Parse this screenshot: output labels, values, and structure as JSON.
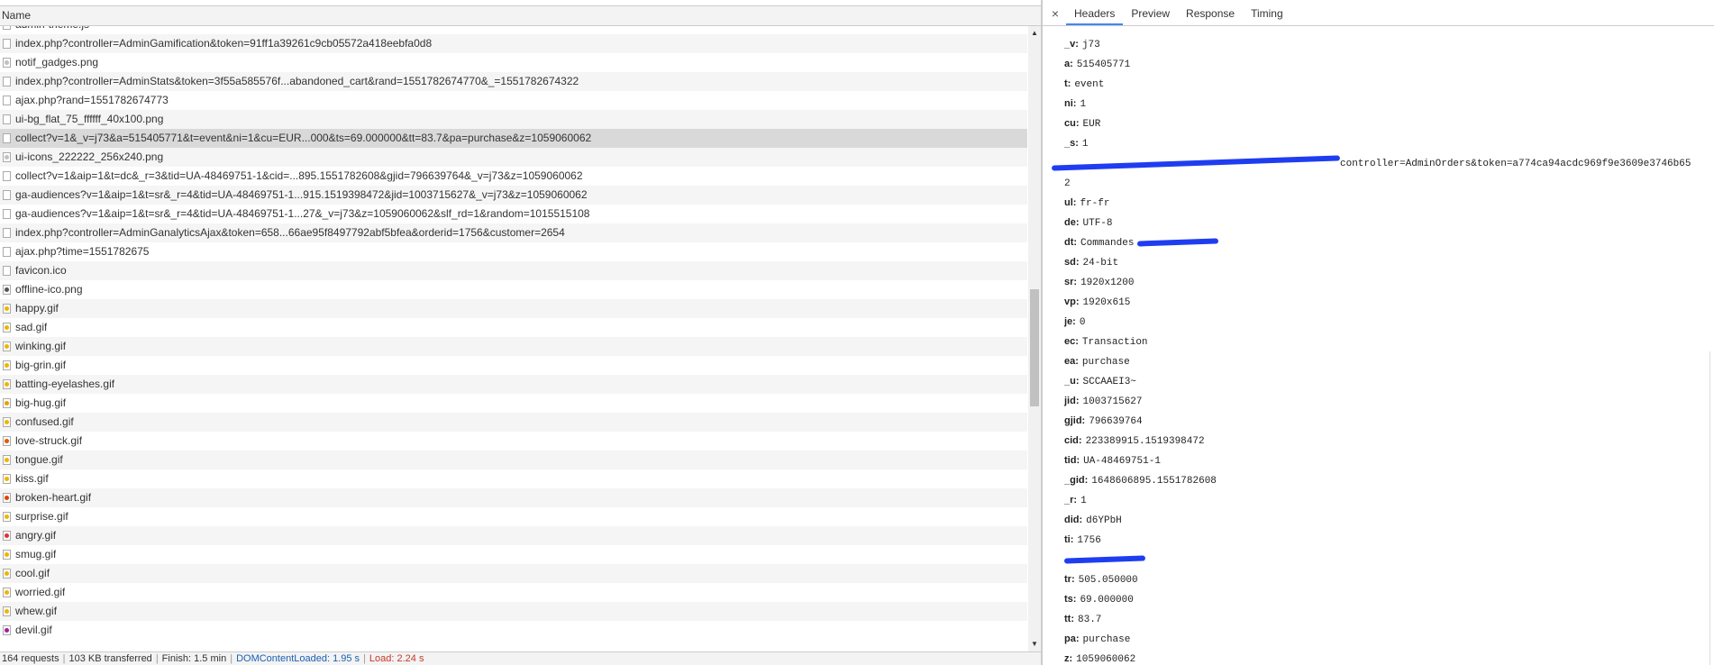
{
  "network": {
    "name_header": "Name",
    "files": [
      {
        "name": "admin-theme.js",
        "icon": "file-icon",
        "color": ""
      },
      {
        "name": "index.php?controller=AdminGamification&token=91ff1a39261c9cb05572a418eebfa0d8",
        "icon": "file-icon",
        "color": ""
      },
      {
        "name": "notif_gadges.png",
        "icon": "image-icon",
        "color": "#c0c0c0"
      },
      {
        "name": "index.php?controller=AdminStats&token=3f55a585576f...abandoned_cart&rand=1551782674770&_=1551782674322",
        "icon": "file-icon",
        "color": ""
      },
      {
        "name": "ajax.php?rand=1551782674773",
        "icon": "file-icon",
        "color": ""
      },
      {
        "name": "ui-bg_flat_75_ffffff_40x100.png",
        "icon": "file-icon",
        "color": ""
      },
      {
        "name": "collect?v=1&_v=j73&a=515405771&t=event&ni=1&cu=EUR...000&ts=69.000000&tt=83.7&pa=purchase&z=1059060062",
        "icon": "file-icon",
        "color": ""
      },
      {
        "name": "ui-icons_222222_256x240.png",
        "icon": "image-icon",
        "color": "#c0c0c0"
      },
      {
        "name": "collect?v=1&aip=1&t=dc&_r=3&tid=UA-48469751-1&cid=...895.1551782608&gjid=796639764&_v=j73&z=1059060062",
        "icon": "file-icon",
        "color": ""
      },
      {
        "name": "ga-audiences?v=1&aip=1&t=sr&_r=4&tid=UA-48469751-1...915.1519398472&jid=1003715627&_v=j73&z=1059060062",
        "icon": "file-icon",
        "color": ""
      },
      {
        "name": "ga-audiences?v=1&aip=1&t=sr&_r=4&tid=UA-48469751-1...27&_v=j73&z=1059060062&slf_rd=1&random=1015515108",
        "icon": "file-icon",
        "color": ""
      },
      {
        "name": "index.php?controller=AdminGanalyticsAjax&token=658...66ae95f8497792abf5bfea&orderid=1756&customer=2654",
        "icon": "file-icon",
        "color": ""
      },
      {
        "name": "ajax.php?time=1551782675",
        "icon": "file-icon",
        "color": ""
      },
      {
        "name": "favicon.ico",
        "icon": "file-icon",
        "color": ""
      },
      {
        "name": "offline-ico.png",
        "icon": "image-icon",
        "color": "#555555"
      },
      {
        "name": "happy.gif",
        "icon": "emoji-icon",
        "color": "#f0b400"
      },
      {
        "name": "sad.gif",
        "icon": "emoji-icon",
        "color": "#f0b400"
      },
      {
        "name": "winking.gif",
        "icon": "emoji-icon",
        "color": "#f0b400"
      },
      {
        "name": "big-grin.gif",
        "icon": "emoji-icon",
        "color": "#f0b400"
      },
      {
        "name": "batting-eyelashes.gif",
        "icon": "emoji-icon",
        "color": "#f0b400"
      },
      {
        "name": "big-hug.gif",
        "icon": "emoji-icon",
        "color": "#e8a000"
      },
      {
        "name": "confused.gif",
        "icon": "emoji-icon",
        "color": "#f0b400"
      },
      {
        "name": "love-struck.gif",
        "icon": "emoji-icon",
        "color": "#e05a00"
      },
      {
        "name": "tongue.gif",
        "icon": "emoji-icon",
        "color": "#f0b400"
      },
      {
        "name": "kiss.gif",
        "icon": "emoji-icon",
        "color": "#f0b400"
      },
      {
        "name": "broken-heart.gif",
        "icon": "emoji-icon",
        "color": "#e04000"
      },
      {
        "name": "surprise.gif",
        "icon": "emoji-icon",
        "color": "#f0b400"
      },
      {
        "name": "angry.gif",
        "icon": "emoji-icon",
        "color": "#e03030"
      },
      {
        "name": "smug.gif",
        "icon": "emoji-icon",
        "color": "#f0b400"
      },
      {
        "name": "cool.gif",
        "icon": "emoji-icon",
        "color": "#f0b400"
      },
      {
        "name": "worried.gif",
        "icon": "emoji-icon",
        "color": "#f0b400"
      },
      {
        "name": "whew.gif",
        "icon": "emoji-icon",
        "color": "#f0b400"
      },
      {
        "name": "devil.gif",
        "icon": "emoji-icon",
        "color": "#a020a0"
      }
    ],
    "selected_index": 6,
    "status": {
      "requests": "164 requests",
      "transferred": "103 KB transferred",
      "finish": "Finish: 1.5 min",
      "dom_content_loaded": "DOMContentLoaded: 1.95 s",
      "load": "Load: 2.24 s"
    }
  },
  "details": {
    "close_label": "×",
    "tabs": [
      {
        "label": "Headers",
        "active": true
      },
      {
        "label": "Preview",
        "active": false
      },
      {
        "label": "Response",
        "active": false
      },
      {
        "label": "Timing",
        "active": false
      }
    ],
    "params": [
      {
        "key": "_v:",
        "value": "j73"
      },
      {
        "key": "a:",
        "value": "515405771"
      },
      {
        "key": "t:",
        "value": "event"
      },
      {
        "key": "ni:",
        "value": "1"
      },
      {
        "key": "cu:",
        "value": "EUR"
      },
      {
        "key": "_s:",
        "value": "1"
      },
      {
        "key": "",
        "value": "controller=AdminOrders&token=a774ca94acdc969f9e3609e3746b65",
        "redacted": "prefix"
      },
      {
        "key": "",
        "value": "2"
      },
      {
        "key": "ul:",
        "value": "fr-fr"
      },
      {
        "key": "de:",
        "value": "UTF-8"
      },
      {
        "key": "dt:",
        "value": "Commandes",
        "redacted": "suffix"
      },
      {
        "key": "sd:",
        "value": "24-bit"
      },
      {
        "key": "sr:",
        "value": "1920x1200"
      },
      {
        "key": "vp:",
        "value": "1920x615"
      },
      {
        "key": "je:",
        "value": "0"
      },
      {
        "key": "ec:",
        "value": "Transaction"
      },
      {
        "key": "ea:",
        "value": "purchase"
      },
      {
        "key": "_u:",
        "value": "SCCAAEI3~"
      },
      {
        "key": "jid:",
        "value": "1003715627"
      },
      {
        "key": "gjid:",
        "value": "796639764"
      },
      {
        "key": "cid:",
        "value": "223389915.1519398472"
      },
      {
        "key": "tid:",
        "value": "UA-48469751-1"
      },
      {
        "key": "_gid:",
        "value": "1648606895.1551782608"
      },
      {
        "key": "_r:",
        "value": "1"
      },
      {
        "key": "did:",
        "value": "d6YPbH"
      },
      {
        "key": "ti:",
        "value": "1756"
      },
      {
        "key": "",
        "value": "",
        "redacted": "full"
      },
      {
        "key": "tr:",
        "value": "505.050000"
      },
      {
        "key": "ts:",
        "value": "69.000000"
      },
      {
        "key": "tt:",
        "value": "83.7"
      },
      {
        "key": "pa:",
        "value": "purchase"
      },
      {
        "key": "z:",
        "value": "1059060062"
      }
    ],
    "redaction_color": "#1f3df0"
  }
}
